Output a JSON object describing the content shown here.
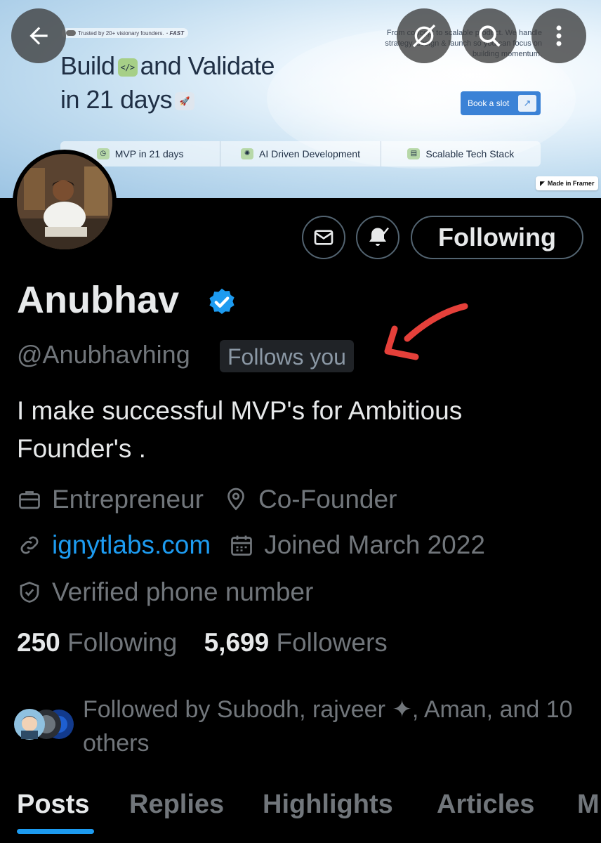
{
  "banner": {
    "trusted": "Trusted by 20+ visionary founders.",
    "fast": "FAST",
    "headline_line1_a": "Build",
    "headline_line1_b": "and Validate",
    "headline_line2": "in 21 days",
    "concept_line1": "From concept to scalable product. We handle",
    "concept_line2": "strategy, design & launch so you can focus on",
    "concept_line3": "building momentum.",
    "book_label": "Book a slot",
    "features": [
      "MVP in 21 days",
      "AI Driven Development",
      "Scalable Tech Stack"
    ],
    "made_in": "Made in Framer"
  },
  "profile": {
    "name": "Anubhav",
    "handle": "@Anubhavhing",
    "follows_you": "Follows you",
    "following_button": "Following",
    "bio": "I make successful MVP's for Ambitious Founder's .",
    "occupation": "Entrepreneur",
    "location": "Co-Founder",
    "website": "ignytlabs.com",
    "joined": "Joined March 2022",
    "verified_phone": "Verified phone number",
    "following_count": "250",
    "following_label": "Following",
    "followers_count": "5,699",
    "followers_label": "Followers",
    "followed_by": "Followed by Subodh, rajveer ✦, Aman, and 10 others"
  },
  "tabs": [
    "Posts",
    "Replies",
    "Highlights",
    "Articles",
    "M"
  ],
  "colors": {
    "accent": "#1d9bf0",
    "background": "#000000",
    "muted": "#71767b",
    "annotation_arrow": "#e5403a"
  },
  "icons": [
    "back-arrow-icon",
    "hide-icon",
    "search-icon",
    "more-icon",
    "mail-icon",
    "bell-icon",
    "verified-badge-icon",
    "briefcase-icon",
    "location-icon",
    "link-icon",
    "calendar-icon",
    "shield-icon"
  ]
}
